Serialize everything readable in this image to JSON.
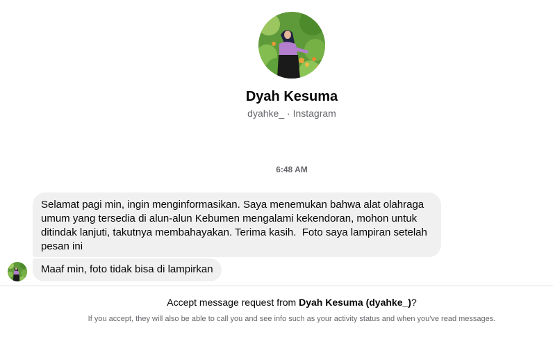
{
  "profile": {
    "name": "Dyah Kesuma",
    "username": "dyahke_",
    "separator": " · ",
    "platform": "Instagram"
  },
  "conversation": {
    "timestamp": "6:48 AM",
    "messages": [
      {
        "text": "Selamat pagi min, ingin menginformasikan. Saya menemukan bahwa alat olahraga\numum yang tersedia di alun-alun Kebumen mengalami kekendoran, mohon untuk\nditindak lanjuti, takutnya membahayakan. Terima kasih.  Foto saya lampiran setelah\npesan ini"
      },
      {
        "text": "Maaf min, foto tidak bisa di lampirkan"
      }
    ]
  },
  "request": {
    "prefix": "Accept message request from ",
    "name": "Dyah Kesuma (dyahke_)",
    "suffix": "?",
    "note": "If you accept, they will also be able to call you and see info such as your activity status and when you've read messages."
  },
  "colors": {
    "bubble": "#f0f0f0",
    "secondary_text": "#65676b",
    "divider": "#dcdde0"
  }
}
